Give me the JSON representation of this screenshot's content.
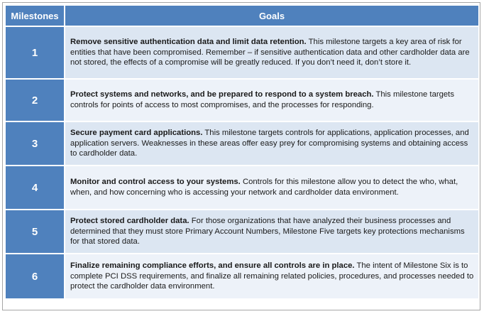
{
  "table": {
    "headers": {
      "milestones": "Milestones",
      "goals": "Goals"
    },
    "rows": [
      {
        "number": "1",
        "title": "Remove sensitive authentication data and limit data retention.",
        "text": " This milestone targets a key area of risk for entities that have been compromised. Remember – if sensitive authentication data and other cardholder data are not stored, the effects of a compromise will be greatly reduced. If you don’t need it, don’t store it."
      },
      {
        "number": "2",
        "title": "Protect systems and networks, and be prepared to respond to a system breach.",
        "text": "  This milestone targets controls for points of access to most compromises, and the processes for responding."
      },
      {
        "number": "3",
        "title": "Secure payment card applications.",
        "text": "  This milestone targets controls for applications, application processes, and application servers. Weaknesses in these areas offer easy prey for compromising systems and obtaining access to cardholder data."
      },
      {
        "number": "4",
        "title": "Monitor and control access to your systems.",
        "text": " Controls for this milestone allow you to detect the who, what, when, and how concerning who is accessing your network and cardholder data environment."
      },
      {
        "number": "5",
        "title": "Protect stored cardholder data.",
        "text": "  For those organizations that have analyzed their business processes and determined that they must store Primary Account Numbers, Milestone Five targets key protections mechanisms for that stored data."
      },
      {
        "number": "6",
        "title": "Finalize remaining compliance efforts, and ensure all controls are in place.",
        "text": " The intent of Milestone Six is to complete PCI DSS requirements, and finalize all remaining related policies, procedures, and processes needed to protect the cardholder data environment."
      }
    ]
  },
  "colors": {
    "header_bg": "#4f81bd",
    "number_bg": "#4f81bd",
    "goal_band_a": "#dce6f2",
    "goal_band_b": "#edf2f9",
    "text": "#1a1a1a",
    "header_text": "#ffffff"
  }
}
